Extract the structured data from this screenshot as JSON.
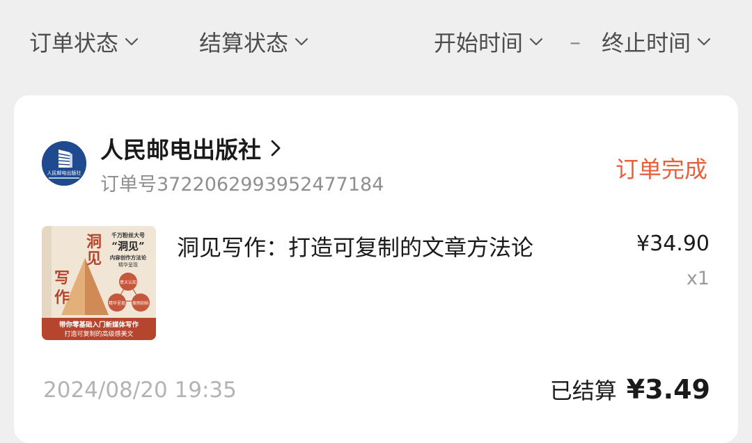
{
  "filters": {
    "order_status": "订单状态",
    "settle_status": "结算状态",
    "start_time": "开始时间",
    "separator": "–",
    "end_time": "终止时间"
  },
  "order": {
    "shop_name": "人民邮电出版社",
    "shop_logo_text": "人民邮电出版社",
    "order_number": "订单号3722062993952477184",
    "status": "订单完成",
    "status_color": "#e8603c",
    "product": {
      "title": "洞见写作：打造可复制的文章方法论",
      "price": "¥34.90",
      "quantity": "x1",
      "cover": {
        "title_chars": [
          "洞",
          "见",
          "写",
          "作"
        ],
        "top_note": "千万粉丝大号",
        "headline": "“洞见”",
        "subline": "内容创作方法论",
        "subline2": "精华呈现",
        "circle_top": "意义认知",
        "circle_left": "精华呈现",
        "circle_right": "案例剖析",
        "banner_line1": "带你零基础入门新媒体写作",
        "banner_line2": "打造可复制的高级感美文"
      }
    },
    "time": "2024/08/20 19:35",
    "settle_label": "已结算",
    "settle_amount": "¥3.49"
  }
}
